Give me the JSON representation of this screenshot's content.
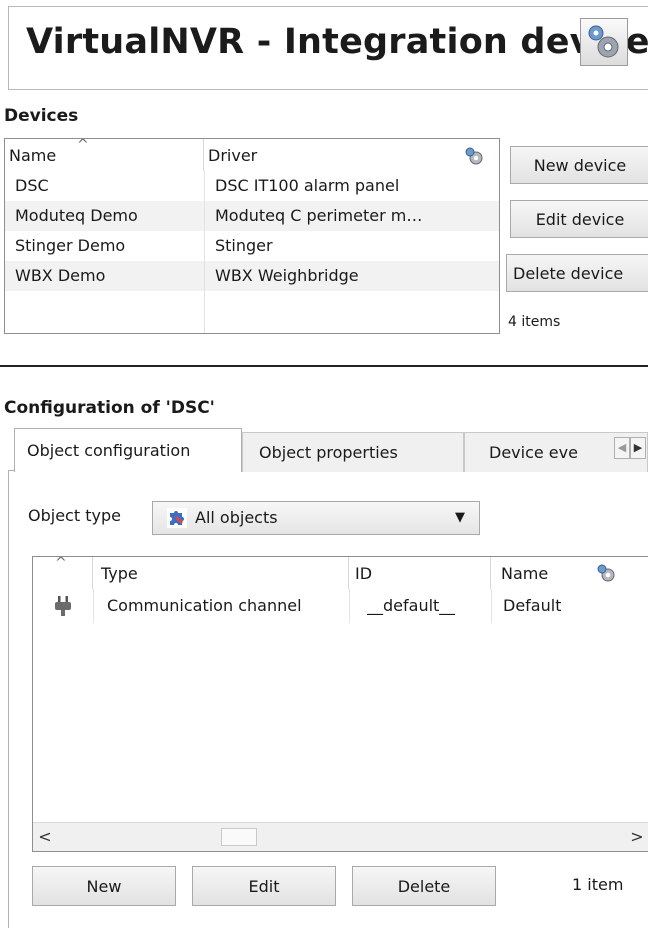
{
  "title": "VirtualNVR - Integration devices",
  "devices": {
    "label": "Devices",
    "columns": [
      "Name",
      "Driver"
    ],
    "rows": [
      {
        "name": "DSC",
        "driver": "DSC IT100 alarm panel"
      },
      {
        "name": "Moduteq Demo",
        "driver": "Moduteq C perimeter m…"
      },
      {
        "name": "Stinger Demo",
        "driver": "Stinger"
      },
      {
        "name": "WBX Demo",
        "driver": "WBX Weighbridge"
      }
    ],
    "buttons": {
      "new": "New device",
      "edit": "Edit device",
      "delete": "Delete device"
    },
    "count": "4 items"
  },
  "configuration": {
    "label": "Configuration of 'DSC'",
    "tabs": [
      {
        "label": "Object configuration",
        "active": true
      },
      {
        "label": "Object properties",
        "active": false
      },
      {
        "label": "Device eve",
        "active": false
      }
    ],
    "object_type": {
      "label": "Object type",
      "value": "All objects"
    },
    "objects": {
      "columns": [
        "Type",
        "ID",
        "Name"
      ],
      "rows": [
        {
          "type": "Communication channel",
          "id": "__default__",
          "name": "Default"
        }
      ]
    },
    "buttons": {
      "new": "New",
      "edit": "Edit",
      "delete": "Delete"
    },
    "count": "1 item"
  },
  "icons": [
    "gear-icon",
    "plug-icon",
    "puzzle-icon",
    "chevron-down-icon",
    "scroll-left-icon",
    "scroll-right-icon",
    "tab-scroll-left-icon",
    "tab-scroll-right-icon",
    "sort-up-icon"
  ],
  "colors": {
    "row_alt": "#f2f2f2",
    "button_border": "#a9a9a9",
    "divider": "#222222"
  }
}
